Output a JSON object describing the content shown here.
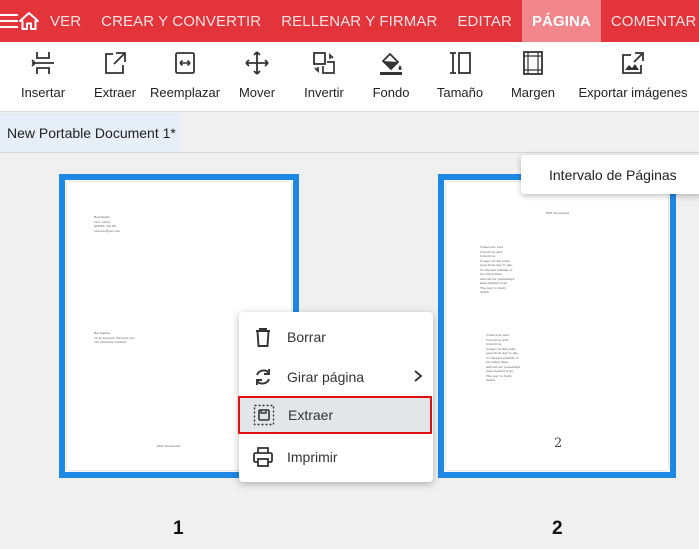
{
  "topbar": {
    "tabs": [
      {
        "label": "VER"
      },
      {
        "label": "CREAR Y CONVERTIR"
      },
      {
        "label": "RELLENAR Y FIRMAR"
      },
      {
        "label": "EDITAR"
      },
      {
        "label": "PÁGINA",
        "active": true
      },
      {
        "label": "COMENTAR"
      }
    ],
    "accent_color": "#e4343b",
    "active_tab_color": "#f2878b"
  },
  "toolbar": {
    "tools": [
      {
        "label": "Insertar",
        "icon": "insert-page-icon"
      },
      {
        "label": "Extraer",
        "icon": "extract-page-icon"
      },
      {
        "label": "Reemplazar",
        "icon": "replace-page-icon"
      },
      {
        "label": "Mover",
        "icon": "move-icon"
      },
      {
        "label": "Invertir",
        "icon": "reverse-icon"
      },
      {
        "label": "Fondo",
        "icon": "paint-bucket-icon"
      },
      {
        "label": "Tamaño",
        "icon": "page-size-icon"
      },
      {
        "label": "Margen",
        "icon": "margin-icon"
      },
      {
        "label": "Exportar imágenes",
        "icon": "export-images-icon"
      }
    ]
  },
  "document": {
    "tab_title": "New Portable Document 1*"
  },
  "range_popup": {
    "label": "Intervalo de Páginas"
  },
  "pages": [
    {
      "number": "1",
      "address_block": "Remitente\nxx-x- xxxxx\nXXXXX, XX XX\nxxxxxxx@xxx.xxx",
      "recipient_block": "Recipiente\nxx xx xxxxxxx. Xxxxxxx xxx\nxxx xxxxxxxx xxxxxxx",
      "footer": "PDF Document"
    },
    {
      "number": "2",
      "header": "PDF Document",
      "poem_1": "Tomorrow, and\ntomorrow, and\ntomorrow,\nCreeps in this petty\npace from day to day,\nTo the last syllable of\nrecorded time;\nAnd all our yesterdays\nhave lighted fools\nThe way to dusty\ndeath.",
      "poem_2": "Tomorrow, and\ntomorrow, and\ntomorrow,\nCreeps in this petty\npace from day to day,\nTo the last syllable of\nrecorded time;\nAnd all our yesterdays\nhave lighted fools\nThe way to dusty\ndeath.",
      "page_label": "2"
    }
  ],
  "context_menu": {
    "items": [
      {
        "label": "Borrar",
        "icon": "trash-icon"
      },
      {
        "label": "Girar página",
        "icon": "rotate-icon",
        "has_submenu": true
      },
      {
        "label": "Extraer",
        "icon": "extract-icon",
        "highlighted": true
      },
      {
        "label": "Imprimir",
        "icon": "printer-icon"
      }
    ]
  }
}
